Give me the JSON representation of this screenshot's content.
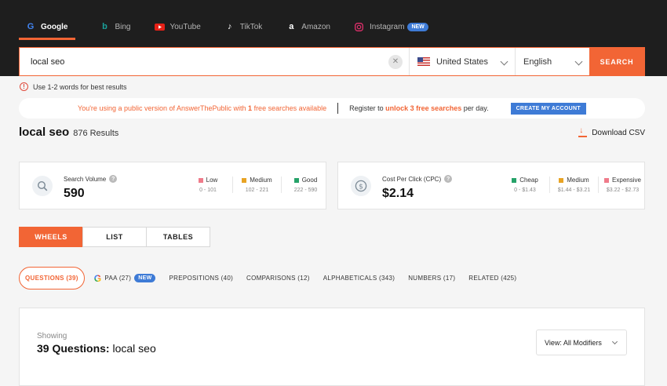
{
  "engines": [
    {
      "label": "Google",
      "icon": "google-icon",
      "active": true
    },
    {
      "label": "Bing",
      "icon": "bing-icon"
    },
    {
      "label": "YouTube",
      "icon": "youtube-icon"
    },
    {
      "label": "TikTok",
      "icon": "tiktok-icon"
    },
    {
      "label": "Amazon",
      "icon": "amazon-icon"
    },
    {
      "label": "Instagram",
      "icon": "instagram-icon",
      "badge": "NEW"
    }
  ],
  "search": {
    "value": "local seo",
    "clear": "✕",
    "country": "United States",
    "language": "English",
    "button": "SEARCH"
  },
  "hint": {
    "icon": "!",
    "text": "Use 1-2 words for best results"
  },
  "promo": {
    "notice": "You're using a public version of AnswerThePublic with ",
    "notice_count": "1",
    "notice_end": " free searches available",
    "register": "Register to ",
    "register_bold": "unlock 3 free searches",
    "register_end": " per day.",
    "cta": "CREATE MY ACCOUNT"
  },
  "results": {
    "keyword": "local seo",
    "count": "876 Results",
    "download": "Download CSV"
  },
  "volume_card": {
    "label": "Search Volume",
    "help": "?",
    "value": "590",
    "legend": [
      {
        "name": "Low",
        "range": "0 - 101",
        "color": "#ef7b8a"
      },
      {
        "name": "Medium",
        "range": "102 - 221",
        "color": "#e8a324"
      },
      {
        "name": "Good",
        "range": "222 - 590",
        "color": "#26a269"
      }
    ]
  },
  "cpc_card": {
    "label": "Cost Per Click (CPC)",
    "help": "?",
    "value": "$2.14",
    "legend": [
      {
        "name": "Cheap",
        "range": "0 - $1.43",
        "color": "#26a269"
      },
      {
        "name": "Medium",
        "range": "$1.44 - $3.21",
        "color": "#e8a324"
      },
      {
        "name": "Expensive",
        "range": "$3.22 - $2.73",
        "color": "#ef7b8a"
      }
    ]
  },
  "view_tabs": [
    "WHEELS",
    "LIST",
    "TABLES"
  ],
  "categories": {
    "questions": "QUESTIONS (39)",
    "paa": "PAA (27)",
    "paa_badge": "NEW",
    "prepositions": "PREPOSITIONS (40)",
    "comparisons": "COMPARISONS (12)",
    "alphabeticals": "ALPHABETICALS (343)",
    "numbers": "NUMBERS (17)",
    "related": "RELATED (425)"
  },
  "panel": {
    "showing": "Showing",
    "title_bold": "39 Questions:",
    "title_rest": " local seo",
    "modifiers": "View: All Modifiers"
  }
}
